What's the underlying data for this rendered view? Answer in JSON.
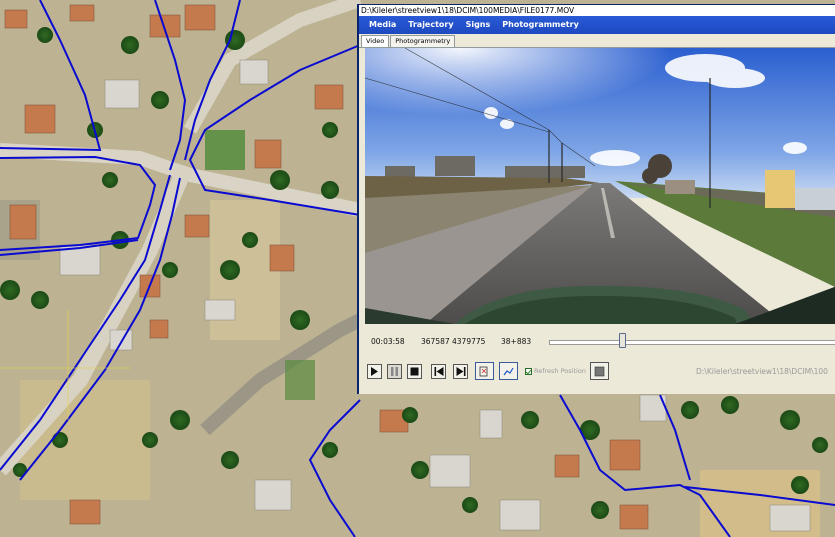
{
  "window": {
    "title": "D:\\Kileler\\streetview1\\18\\DCIM\\100MEDIA\\FILE0177.MOV"
  },
  "menu": {
    "items": [
      "Media",
      "Trajectory",
      "Signs",
      "Photogrammetry"
    ]
  },
  "tabs": [
    "Video",
    "Photogrammetry"
  ],
  "controls": {
    "time": "00:03:58",
    "coordinates": "367587 4379775",
    "position": "38+883",
    "refresh_label": "Refresh Position",
    "refresh_checked": true,
    "path_label": "D:\\Kileler\\streetview1\\18\\DCIM\\100",
    "slider_progress": 0.24
  },
  "colors": {
    "road_lines": "#0a0ad0",
    "menubar": "#2255cc",
    "window_bg": "#ece9d8"
  }
}
